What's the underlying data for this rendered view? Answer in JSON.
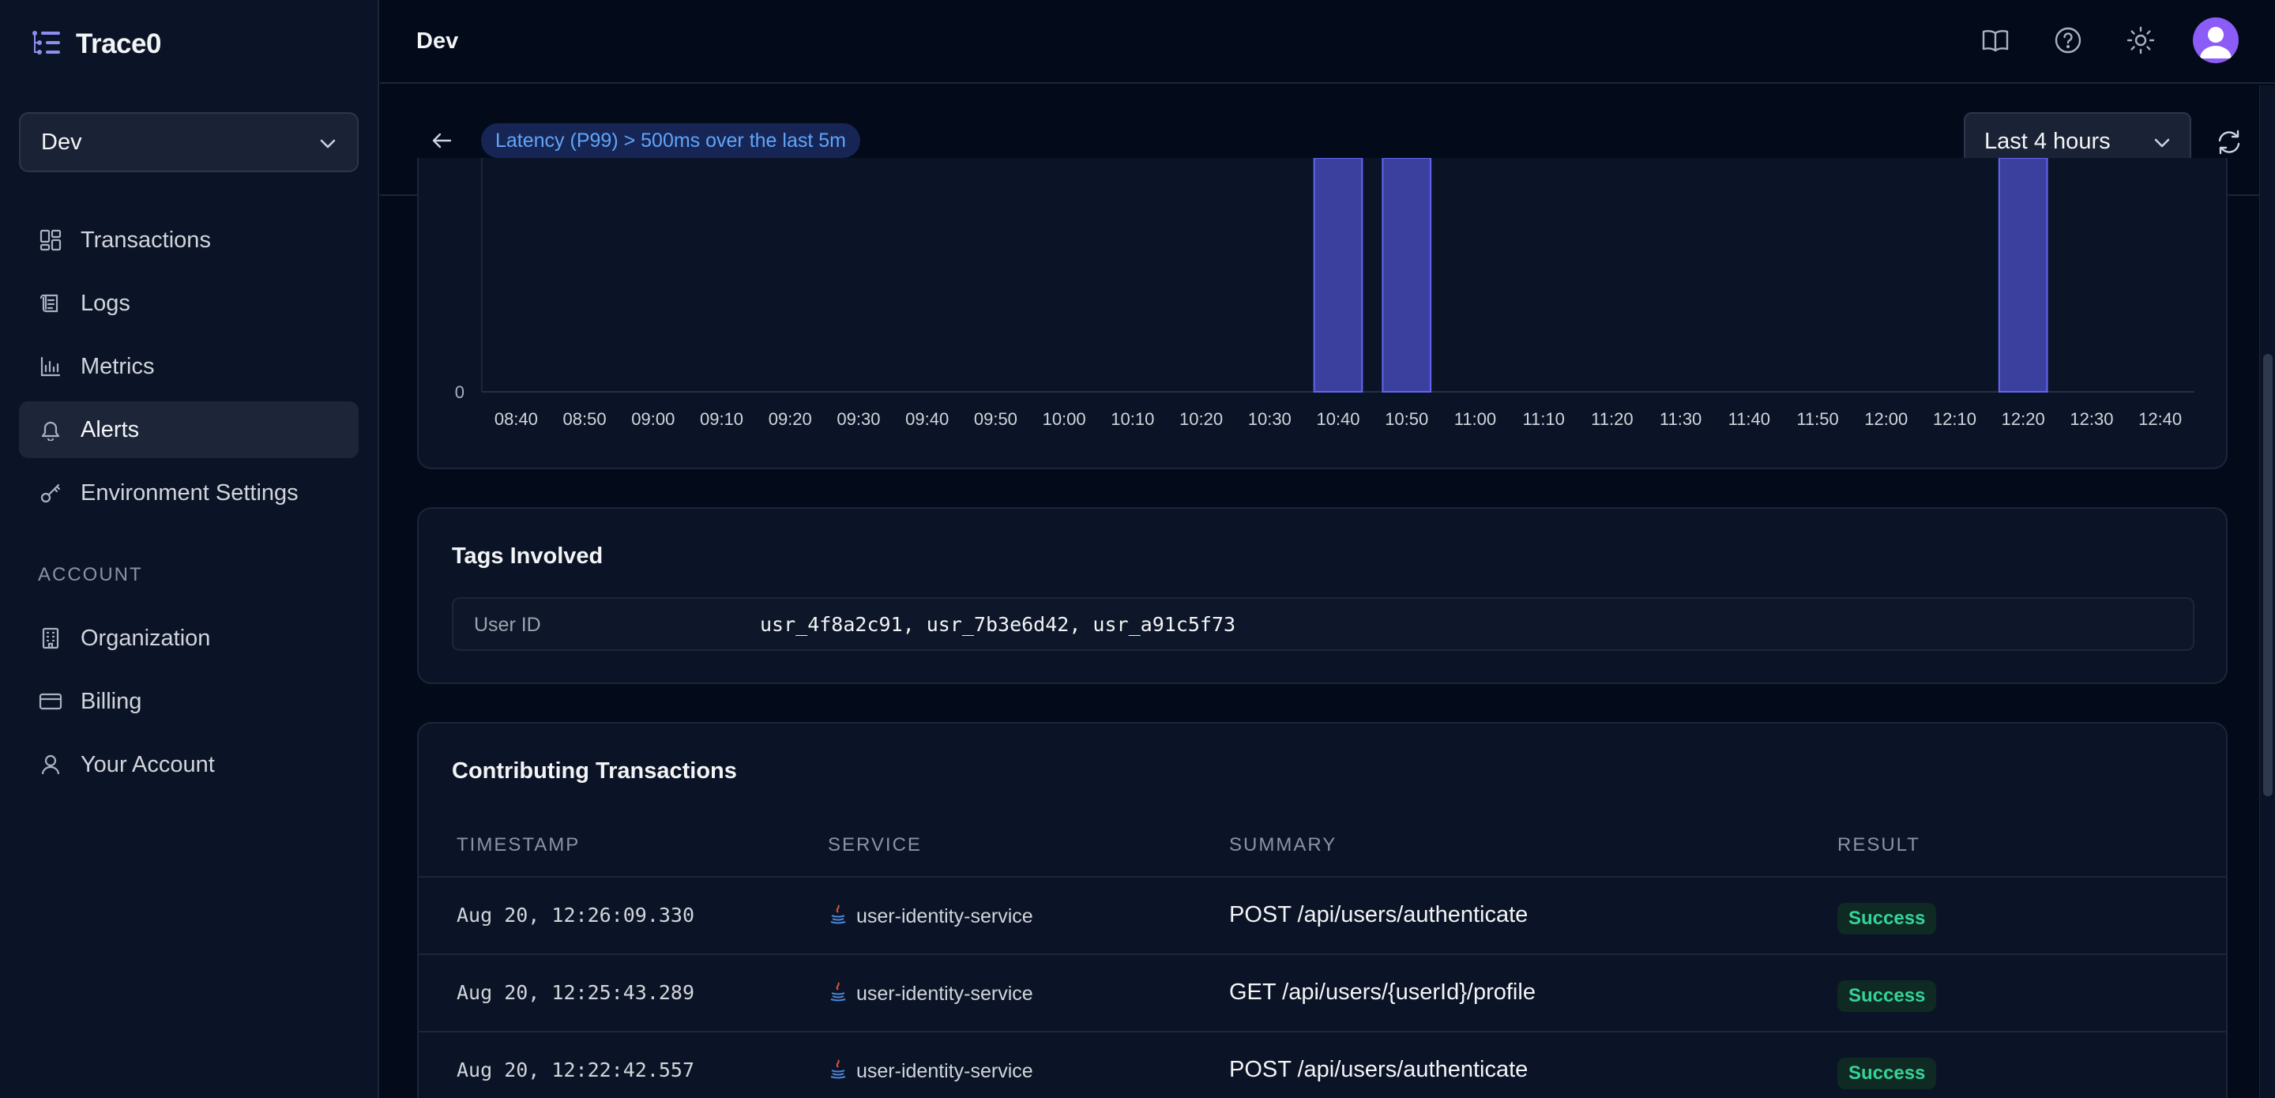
{
  "app": {
    "name": "Trace0"
  },
  "sidebar": {
    "environment": "Dev",
    "items": [
      {
        "label": "Transactions",
        "icon": "grid-icon"
      },
      {
        "label": "Logs",
        "icon": "scroll-icon"
      },
      {
        "label": "Metrics",
        "icon": "chart-icon"
      },
      {
        "label": "Alerts",
        "icon": "bell-icon",
        "active": true
      },
      {
        "label": "Environment Settings",
        "icon": "key-icon"
      }
    ],
    "account_section_label": "ACCOUNT",
    "account_items": [
      {
        "label": "Organization",
        "icon": "building-icon"
      },
      {
        "label": "Billing",
        "icon": "credit-card-icon"
      },
      {
        "label": "Your Account",
        "icon": "user-icon"
      }
    ]
  },
  "header": {
    "title": "Dev",
    "icons": [
      "book-icon",
      "help-icon",
      "sun-icon",
      "avatar"
    ]
  },
  "subheader": {
    "alert_label": "Latency (P99) > 500ms over the last 5m",
    "time_range": "Last 4 hours"
  },
  "chart_data": {
    "type": "bar",
    "y_tick_labels": [
      "0"
    ],
    "x": [
      "08:40",
      "08:50",
      "09:00",
      "09:10",
      "09:20",
      "09:30",
      "09:40",
      "09:50",
      "10:00",
      "10:10",
      "10:20",
      "10:30",
      "10:40",
      "10:50",
      "11:00",
      "11:10",
      "11:20",
      "11:30",
      "11:40",
      "11:50",
      "12:00",
      "12:10",
      "12:20",
      "12:30",
      "12:40"
    ],
    "bars_at": [
      "10:40",
      "10:50",
      "12:20"
    ],
    "bar_color": "#3b3f9e",
    "grid": false
  },
  "tags": {
    "title": "Tags Involved",
    "rows": [
      {
        "key": "User ID",
        "value": "usr_4f8a2c91, usr_7b3e6d42, usr_a91c5f73"
      }
    ]
  },
  "transactions": {
    "title": "Contributing Transactions",
    "columns": [
      "TIMESTAMP",
      "SERVICE",
      "SUMMARY",
      "RESULT"
    ],
    "rows": [
      {
        "timestamp": "Aug 20, 12:26:09.330",
        "service": "user-identity-service",
        "summary": "POST /api/users/authenticate",
        "result": "Success"
      },
      {
        "timestamp": "Aug 20, 12:25:43.289",
        "service": "user-identity-service",
        "summary": "GET /api/users/{userId}/profile",
        "result": "Success"
      },
      {
        "timestamp": "Aug 20, 12:22:42.557",
        "service": "user-identity-service",
        "summary": "POST /api/users/authenticate",
        "result": "Success"
      }
    ]
  }
}
